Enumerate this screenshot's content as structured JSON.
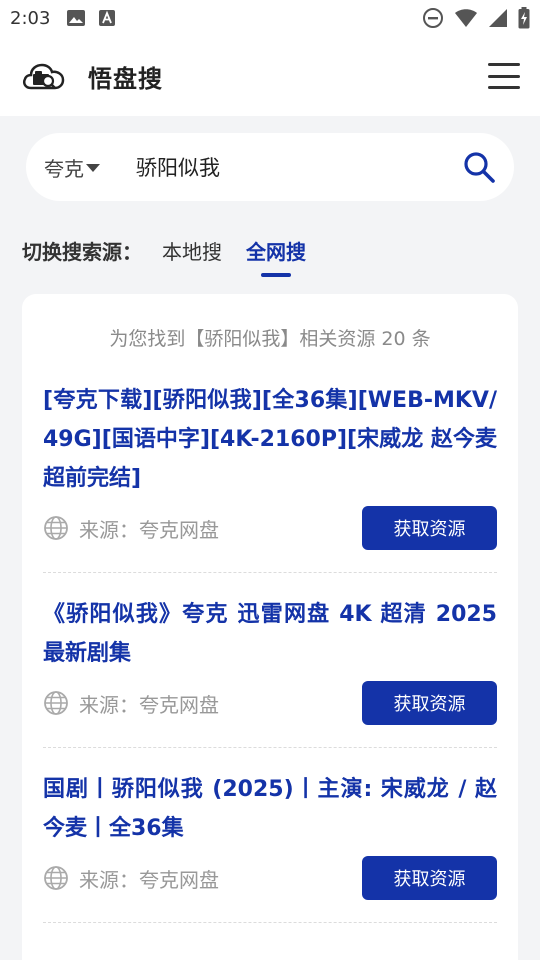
{
  "status_bar": {
    "time": "2:03"
  },
  "header": {
    "title": "悟盘搜"
  },
  "search": {
    "source": "夸克",
    "query": "骄阳似我"
  },
  "switch": {
    "label": "切换搜索源：",
    "tabs": [
      {
        "label": "本地搜",
        "active": false
      },
      {
        "label": "全网搜",
        "active": true
      }
    ]
  },
  "results": {
    "summary": "为您找到【骄阳似我】相关资源 20 条",
    "items": [
      {
        "title": "[夸克下载][骄阳似我][全36集][WEB-MKV/49G][国语中字][4K-2160P][宋威龙 赵今麦 超前完结]",
        "source": "来源：夸克网盘",
        "button": "获取资源"
      },
      {
        "title": "《骄阳似我》夸克 迅雷网盘 4K 超清 2025 最新剧集",
        "source": "来源：夸克网盘",
        "button": "获取资源"
      },
      {
        "title": "国剧丨骄阳似我 (2025)丨主演: 宋威龙 / 赵今麦丨全36集",
        "source": "来源：夸克网盘",
        "button": "获取资源"
      }
    ]
  },
  "colors": {
    "accent": "#1433a8",
    "background": "#f3f4f6",
    "muted_text": "#999999"
  }
}
